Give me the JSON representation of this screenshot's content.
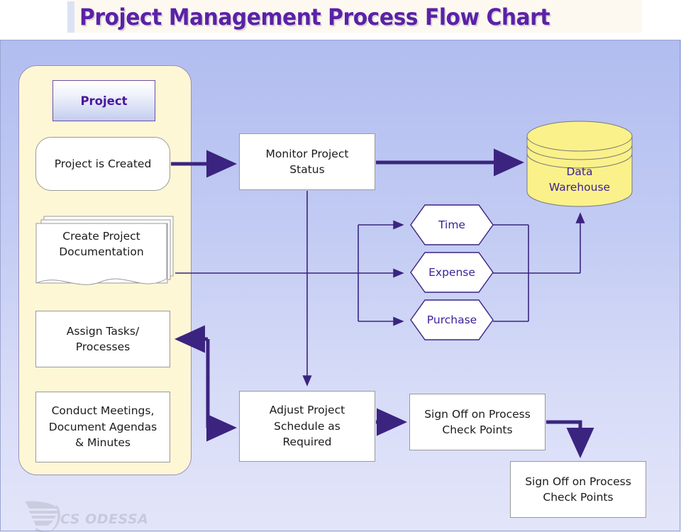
{
  "header": {
    "title": "Project Management Process Flow Chart"
  },
  "colors": {
    "title_purple": "#5b21a8",
    "node_purple": "#3b1f96",
    "connector_purple": "#3b2480",
    "panel_cream": "#fdf7d6",
    "db_yellow": "#fbf18a",
    "canvas_top": "#b1bdf0",
    "canvas_bottom": "#e3e5f9"
  },
  "panel": {
    "name": "Project",
    "header_label": "Project",
    "nodes": [
      {
        "id": "project-is-created",
        "label": "Project is Created",
        "shape": "rounded-rect"
      },
      {
        "id": "create-project-docs",
        "label": "Create Project\nDocumentation",
        "shape": "multi-document"
      },
      {
        "id": "assign-tasks",
        "label": "Assign Tasks/\nProcesses",
        "shape": "rect"
      },
      {
        "id": "conduct-meetings",
        "label": "Conduct Meetings,\nDocument Agendas\n& Minutes",
        "shape": "rect"
      }
    ],
    "node_labels": {
      "project_is_created": "Project is Created",
      "create_project_docs_line1": "Create Project",
      "create_project_docs_line2": "Documentation",
      "assign_tasks_line1": "Assign Tasks/",
      "assign_tasks_line2": "Processes",
      "conduct_meetings_line1": "Conduct Meetings,",
      "conduct_meetings_line2": "Document Agendas",
      "conduct_meetings_line3": "& Minutes"
    }
  },
  "flow": {
    "monitor_status_line1": "Monitor Project",
    "monitor_status_line2": "Status",
    "adjust_schedule_line1": "Adjust Project",
    "adjust_schedule_line2": "Schedule as",
    "adjust_schedule_line3": "Required",
    "signoff_1_line1": "Sign Off on Process",
    "signoff_1_line2": "Check Points",
    "signoff_2_line1": "Sign Off on Process",
    "signoff_2_line2": "Check Points",
    "data_warehouse_line1": "Data",
    "data_warehouse_line2": "Warehouse",
    "hexagons": [
      {
        "id": "time",
        "label": "Time"
      },
      {
        "id": "expense",
        "label": "Expense"
      },
      {
        "id": "purchase",
        "label": "Purchase"
      }
    ],
    "hex_labels": {
      "time": "Time",
      "expense": "Expense",
      "purchase": "Purchase"
    }
  },
  "watermark": {
    "text": "CS ODESSA",
    "icon": "swoosh-logo"
  }
}
